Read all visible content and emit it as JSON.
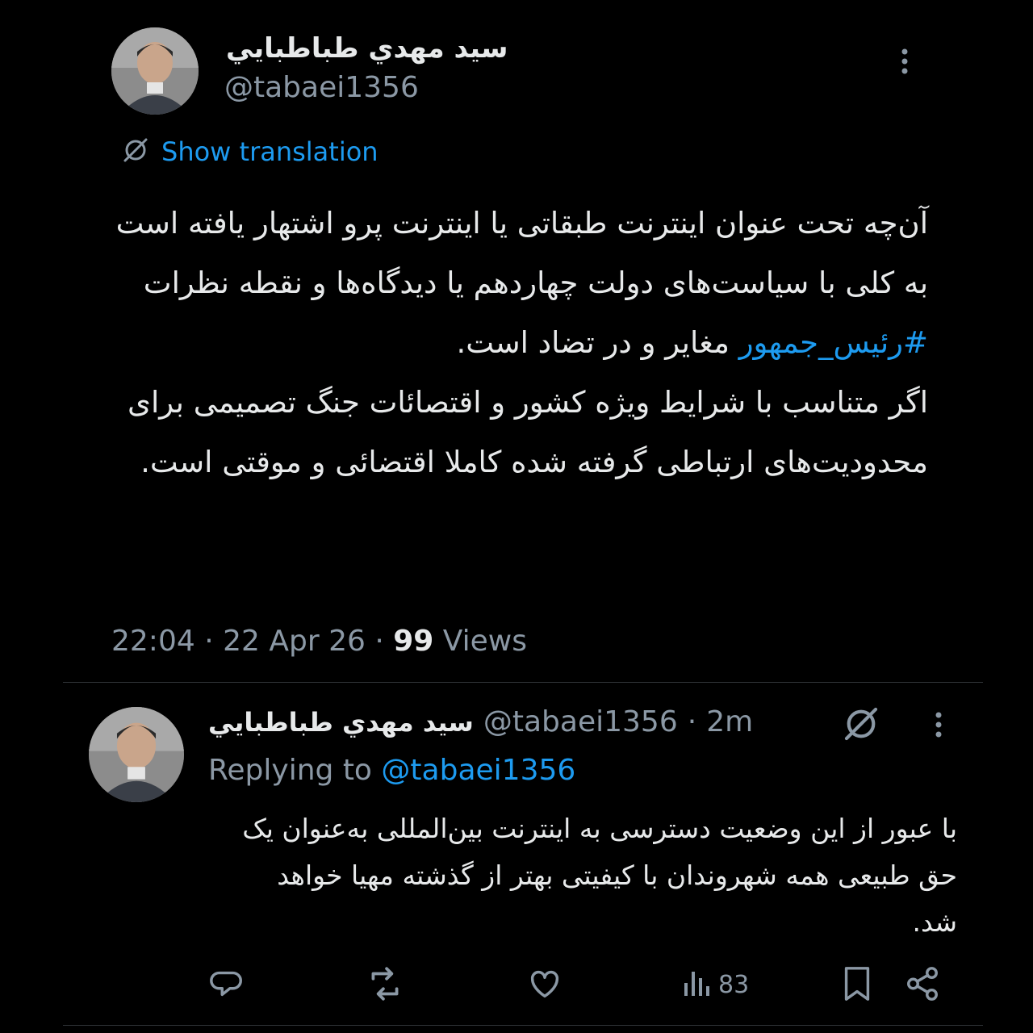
{
  "main_tweet": {
    "author_name": "سيد مهدي طباطبايي",
    "author_handle": "@tabaei1356",
    "show_translation": "Show translation",
    "paragraph1": "آن‌چه تحت عنوان اینترنت طبقاتی یا اینترنت پرو اشتهار یافته است به کلی با سیاست‌های دولت چهاردهم یا دیدگاه‌ها و نقطه نظرات",
    "hashtag": "#رئیس_جمهور",
    "paragraph1_end": "مغایر و در تضاد است.",
    "paragraph2": "اگر متناسب با شرایط ویژه کشور و اقتصائات جنگ تصمیمی برای محدودیت‌های ارتباطی گرفته شده کاملا اقتضائی و موقتی است.",
    "time": "22:04",
    "date": "22 Apr 26",
    "views_count": "99",
    "views_label": "Views"
  },
  "reply_tweet": {
    "author_name": "سيد مهدي طباطبايي",
    "author_handle": "@tabaei1356",
    "age": "2m",
    "replying_label": "Replying to",
    "replying_handle": "@tabaei1356",
    "text": "با عبور از این وضعیت دسترسی به اینترنت بین‌المللی به‌عنوان یک حق طبیعی همه شهروندان با کیفیتی بهتر از گذشته مهیا خواهد شد.",
    "views_count": "83"
  },
  "icons": [
    "more-icon",
    "translate-icon",
    "reply-icon",
    "retweet-icon",
    "like-icon",
    "views-icon",
    "bookmark-icon",
    "share-icon"
  ],
  "colors": {
    "background": "#000000",
    "text": "#e7e9ea",
    "muted": "#8b98a5",
    "link": "#1d9bf0"
  }
}
